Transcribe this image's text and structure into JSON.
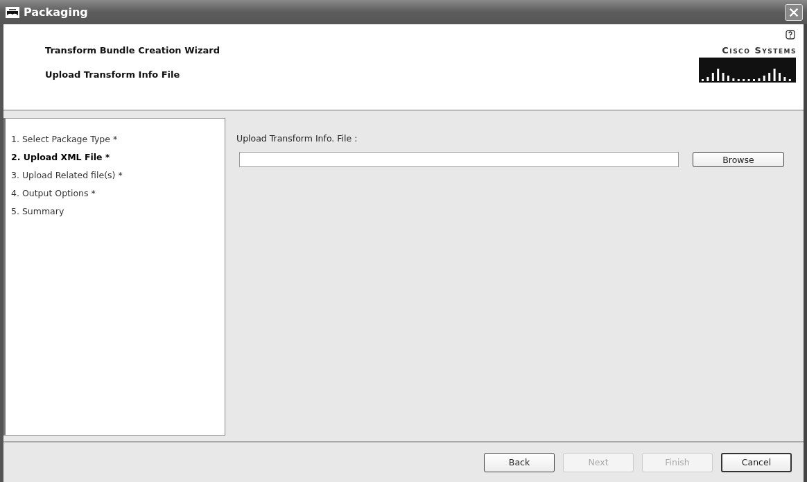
{
  "window": {
    "title": "Packaging"
  },
  "header": {
    "title": "Transform Bundle Creation Wizard",
    "subtitle": "Upload Transform Info File",
    "logo_text": "Cisco Systems"
  },
  "steps": [
    {
      "label": "1. Select Package Type *",
      "selected": false
    },
    {
      "label": "2. Upload XML File *",
      "selected": true
    },
    {
      "label": "3. Upload Related file(s) *",
      "selected": false
    },
    {
      "label": "4. Output Options *",
      "selected": false
    },
    {
      "label": "5. Summary",
      "selected": false
    }
  ],
  "form": {
    "label": "Upload Transform Info. File :",
    "browse_button": "Browse"
  },
  "buttons": [
    {
      "label": "Back",
      "disabled": false,
      "default": false
    },
    {
      "label": "Next",
      "disabled": true,
      "default": false
    },
    {
      "label": "Finish",
      "disabled": true,
      "default": false
    },
    {
      "label": "Cancel",
      "disabled": false,
      "default": true
    }
  ]
}
